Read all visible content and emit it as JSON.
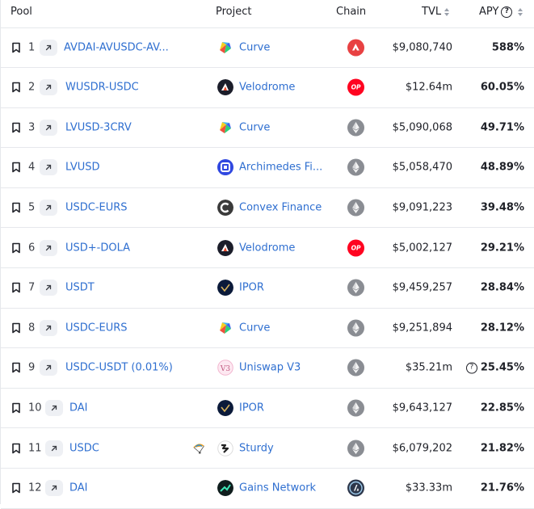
{
  "header": {
    "pool": "Pool",
    "project": "Project",
    "chain": "Chain",
    "tvl": "TVL",
    "apy": "APY",
    "apy_help": "?"
  },
  "rows": [
    {
      "rank": "1",
      "pool": "AVDAI-AVUSDC-AV...",
      "project": "Curve",
      "project_icon": "curve-logo-icon",
      "chain": "avalanche-icon",
      "tvl": "$9,080,740",
      "apy": "588%"
    },
    {
      "rank": "2",
      "pool": "WUSDR-USDC",
      "project": "Velodrome",
      "project_icon": "velodrome-logo-icon",
      "chain": "optimism-icon",
      "chain_text": "OP",
      "tvl": "$12.64m",
      "apy": "60.05%"
    },
    {
      "rank": "3",
      "pool": "LVUSD-3CRV",
      "project": "Curve",
      "project_icon": "curve-logo-icon",
      "chain": "ethereum-icon",
      "tvl": "$5,090,068",
      "apy": "49.71%"
    },
    {
      "rank": "4",
      "pool": "LVUSD",
      "project": "Archimedes Fi...",
      "project_icon": "archimedes-logo-icon",
      "chain": "ethereum-icon",
      "tvl": "$5,058,470",
      "apy": "48.89%"
    },
    {
      "rank": "5",
      "pool": "USDC-EURS",
      "project": "Convex Finance",
      "project_icon": "convex-logo-icon",
      "chain": "ethereum-icon",
      "tvl": "$9,091,223",
      "apy": "39.48%"
    },
    {
      "rank": "6",
      "pool": "USD+-DOLA",
      "project": "Velodrome",
      "project_icon": "velodrome-logo-icon",
      "chain": "optimism-icon",
      "chain_text": "OP",
      "tvl": "$5,002,127",
      "apy": "29.21%"
    },
    {
      "rank": "7",
      "pool": "USDT",
      "project": "IPOR",
      "project_icon": "ipor-logo-icon",
      "chain": "ethereum-icon",
      "tvl": "$9,459,257",
      "apy": "28.84%"
    },
    {
      "rank": "8",
      "pool": "USDC-EURS",
      "project": "Curve",
      "project_icon": "curve-logo-icon",
      "chain": "ethereum-icon",
      "tvl": "$9,251,894",
      "apy": "28.12%"
    },
    {
      "rank": "9",
      "pool": "USDC-USDT (0.01%)",
      "project": "Uniswap V3",
      "project_icon": "uniswap-logo-icon",
      "chain": "ethereum-icon",
      "tvl": "$35.21m",
      "apy": "25.45%",
      "apy_note": "?"
    },
    {
      "rank": "10",
      "pool": "DAI",
      "project": "IPOR",
      "project_icon": "ipor-logo-icon",
      "chain": "ethereum-icon",
      "tvl": "$9,643,127",
      "apy": "22.85%"
    },
    {
      "rank": "11",
      "pool": "USDC",
      "project": "Sturdy",
      "project_icon": "sturdy-logo-icon",
      "chain": "ethereum-icon",
      "tvl": "$6,079,202",
      "apy": "21.82%",
      "extra_icon": "parachute-icon"
    },
    {
      "rank": "12",
      "pool": "DAI",
      "project": "Gains Network",
      "project_icon": "gains-logo-icon",
      "chain": "arbitrum-icon",
      "tvl": "$33.33m",
      "apy": "21.76%"
    }
  ],
  "colors": {
    "link": "#2f6fd0",
    "avalanche": "#e84142",
    "optimism": "#ff0420",
    "ethereum": "#8a8d93",
    "arbitrum": "#2d374b"
  }
}
